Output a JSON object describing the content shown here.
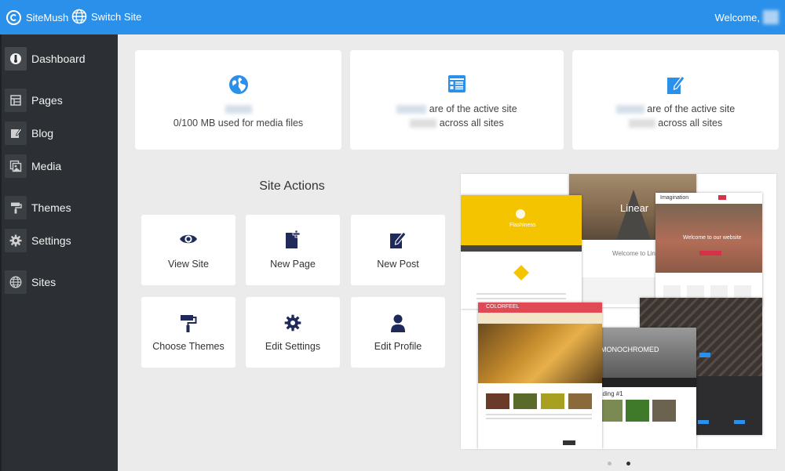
{
  "topbar": {
    "brand": "SiteMush",
    "switch_site": "Switch Site",
    "welcome": "Welcome,"
  },
  "sidebar": {
    "items": [
      {
        "label": "Dashboard",
        "icon": "dashboard-icon"
      },
      {
        "label": "Pages",
        "icon": "pages-icon"
      },
      {
        "label": "Blog",
        "icon": "blog-icon"
      },
      {
        "label": "Media",
        "icon": "media-icon"
      },
      {
        "label": "Themes",
        "icon": "paint-roller-icon"
      },
      {
        "label": "Settings",
        "icon": "gear-icon"
      },
      {
        "label": "Sites",
        "icon": "globe-icon"
      }
    ]
  },
  "stats": {
    "media": {
      "text": "0/100 MB used for media files"
    },
    "pages": {
      "line1": "are of the active site",
      "line2": "across all sites"
    },
    "posts": {
      "line1": "are of the active site",
      "line2": "across all sites"
    }
  },
  "site_actions": {
    "title": "Site Actions",
    "buttons": [
      {
        "label": "View Site",
        "icon": "eye-icon"
      },
      {
        "label": "New Page",
        "icon": "new-page-icon"
      },
      {
        "label": "New Post",
        "icon": "new-post-icon"
      },
      {
        "label": "Choose Themes",
        "icon": "paint-roller-icon"
      },
      {
        "label": "Edit Settings",
        "icon": "gear-icon"
      },
      {
        "label": "Edit Profile",
        "icon": "user-icon"
      }
    ]
  },
  "themes": {
    "flashiness": "Flashiness",
    "linear": "Linear",
    "welcome_linear": "Welcome to Linear",
    "imagination": "Imagination",
    "welcome_website": "Welcome to our website",
    "colorfeel": "COLORFEEL",
    "monochromed": "MONOCHROMED",
    "heading": "ading #1"
  },
  "colors": {
    "topbar": "#2b90ea",
    "sidebar": "#2c3034",
    "icon_navy": "#1f3c88",
    "icon_blue": "#2b90ea"
  }
}
